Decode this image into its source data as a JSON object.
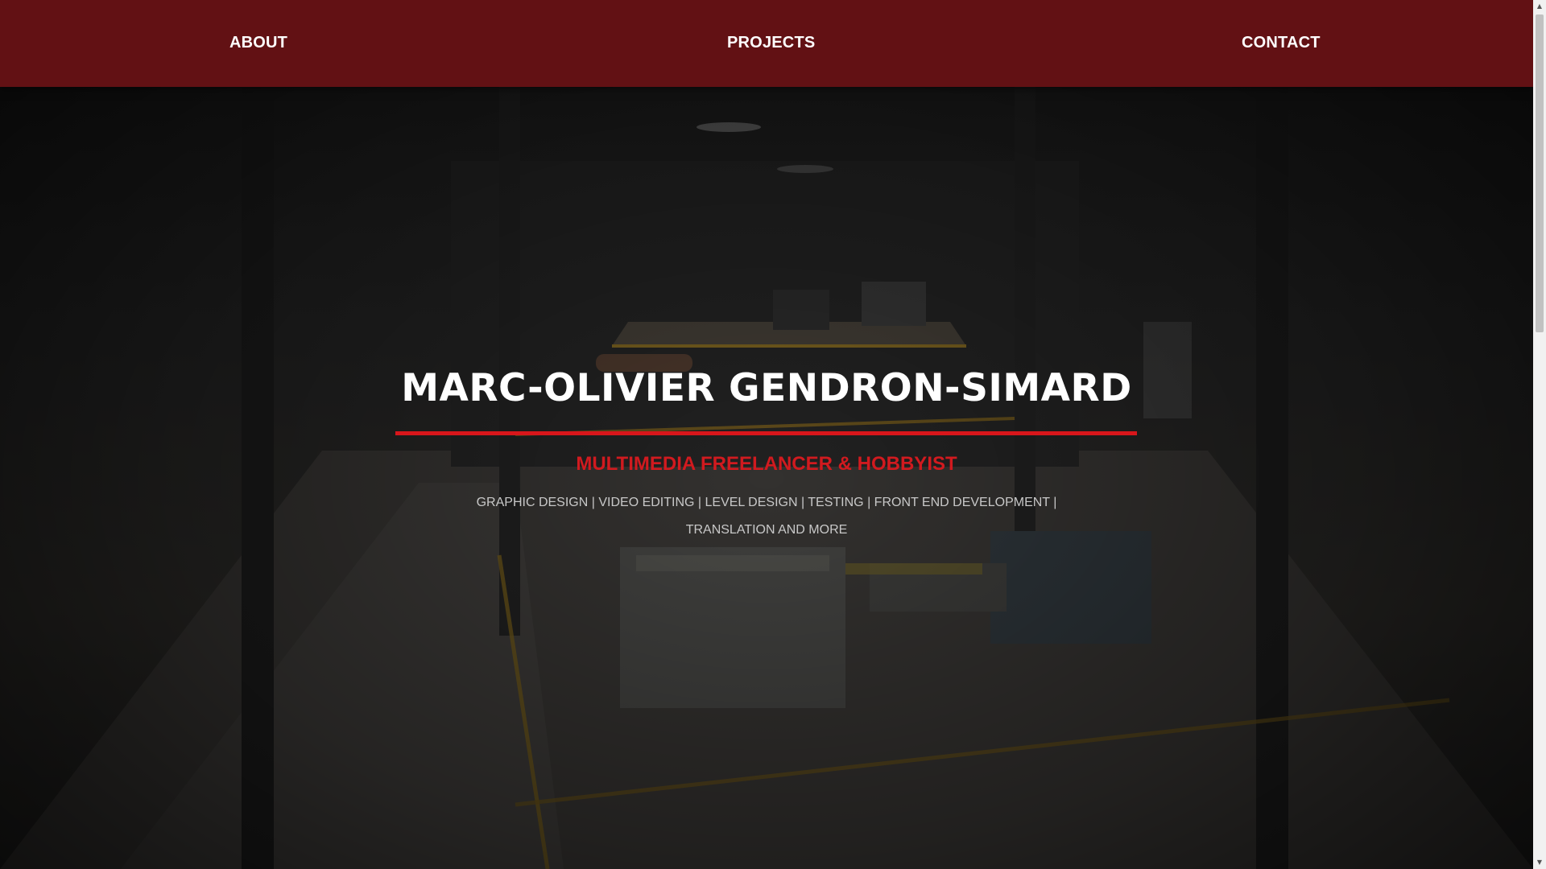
{
  "nav": {
    "items": [
      {
        "label": "ABOUT"
      },
      {
        "label": "PROJECTS"
      },
      {
        "label": "CONTACT"
      }
    ]
  },
  "hero": {
    "title": "MARC-OLIVIER GENDRON-SIMARD",
    "subtitle": "MULTIMEDIA FREELANCER & HOBBYIST",
    "skills": "GRAPHIC DESIGN | VIDEO EDITING | LEVEL DESIGN | TESTING | FRONT END DEVELOPMENT | TRANSLATION AND MORE"
  },
  "colors": {
    "nav_background": "#621114",
    "accent_red": "#d8161b",
    "subtitle_red": "#d11a1f",
    "title_text": "#ffffff"
  },
  "icons": {
    "scroll_up": "scroll-up-arrow-icon",
    "scroll_down": "scroll-down-arrow-icon"
  }
}
